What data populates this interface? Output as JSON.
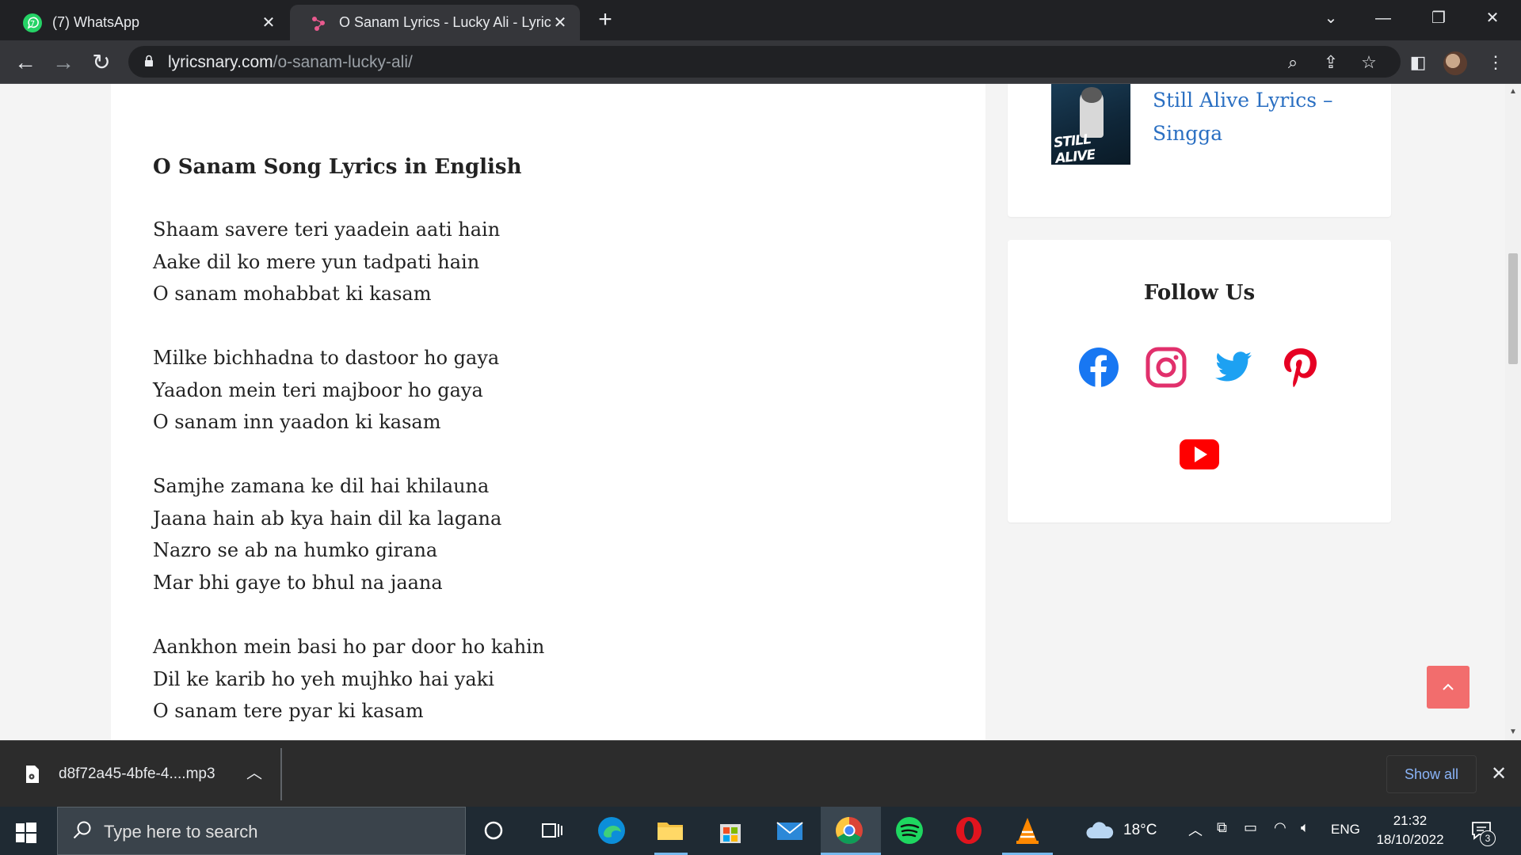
{
  "browser": {
    "tabs": [
      {
        "title": "(7) WhatsApp"
      },
      {
        "title": "O Sanam Lyrics - Lucky Ali - Lyric"
      }
    ],
    "url_domain": "lyricsnary.com",
    "url_path": "/o-sanam-lucky-ali/"
  },
  "article": {
    "heading": "O Sanam Song Lyrics in English",
    "stanzas": [
      [
        "Shaam savere teri yaadein aati hain",
        "Aake dil ko mere yun tadpati hain",
        "O sanam mohabbat ki kasam"
      ],
      [
        "Milke bichhadna to dastoor ho gaya",
        "Yaadon mein teri majboor ho gaya",
        "O sanam inn yaadon ki kasam"
      ],
      [
        "Samjhe zamana ke dil hai khilauna",
        "Jaana hain ab kya hain dil ka lagana",
        "Nazro se ab na humko girana",
        "Mar bhi gaye to bhul na jaana"
      ],
      [
        "Aankhon mein basi ho par door ho kahin",
        "Dil ke karib ho yeh mujhko hai yaki",
        "O sanam tere pyar ki kasam"
      ]
    ]
  },
  "sidebar": {
    "recent_post": {
      "title": "Still Alive Lyrics – Singga",
      "thumb_text": "STILL ALIVE"
    },
    "follow": {
      "title": "Follow Us",
      "icons": [
        "facebook-icon",
        "instagram-icon",
        "twitter-icon",
        "pinterest-icon",
        "youtube-icon"
      ]
    }
  },
  "downloads": {
    "file_name": "d8f72a45-4bfe-4....mp3",
    "show_all": "Show all"
  },
  "taskbar": {
    "search_placeholder": "Type here to search",
    "temperature": "18°C",
    "language": "ENG",
    "time": "21:32",
    "date": "18/10/2022",
    "notification_count": "3"
  },
  "colors": {
    "link": "#2a6fc2",
    "facebook": "#1877f2",
    "instagram": "#e1306c",
    "twitter": "#1da1f2",
    "pinterest": "#e60023",
    "youtube": "#ff0000",
    "scroll_top": "#f26d6d"
  }
}
